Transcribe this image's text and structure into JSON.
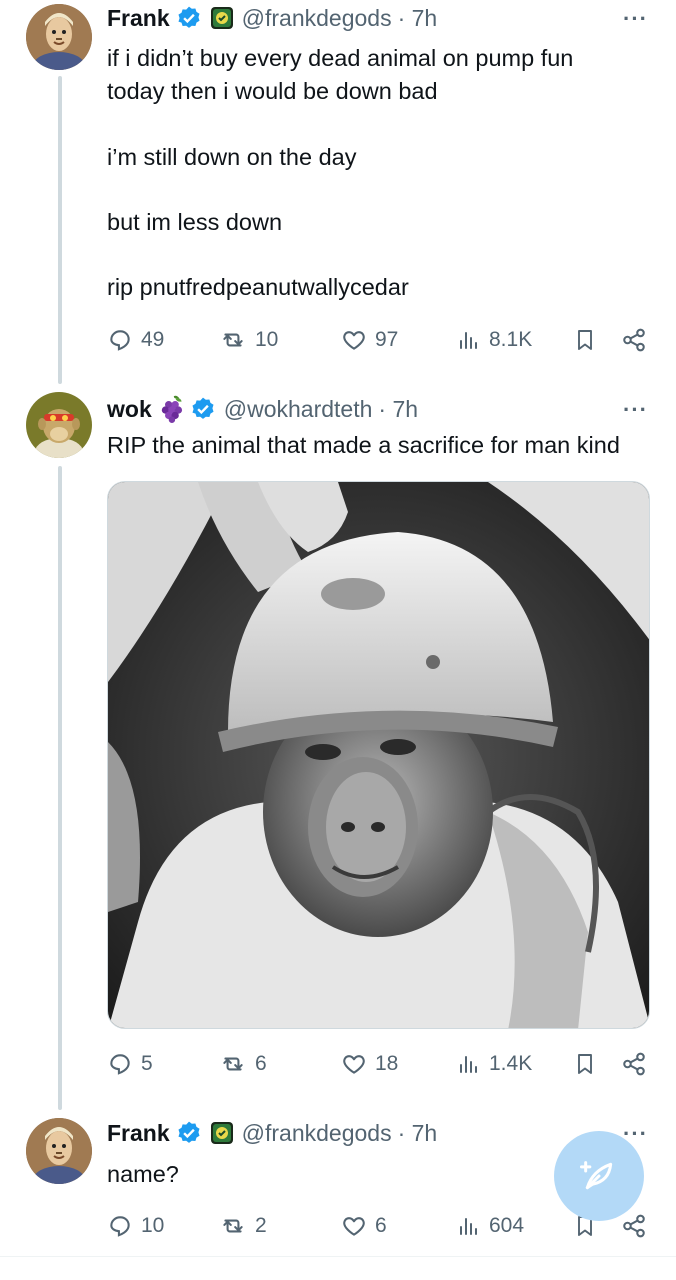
{
  "tweets": [
    {
      "name": "Frank",
      "handle": "@frankdegods",
      "time": "· 7h",
      "paragraphs": [
        "if i didn’t buy every dead animal on pump fun today then i would be down bad",
        "i’m still down on the day",
        "but im less down",
        "rip pnutfredpeanutwallycedar"
      ],
      "replies": "49",
      "reposts": "10",
      "likes": "97",
      "views": "8.1K"
    },
    {
      "name": "wok",
      "handle": "@wokhardteth",
      "time": "· 7h",
      "paragraphs": [
        "RIP the animal that made a sacrifice for man kind"
      ],
      "replies": "5",
      "reposts": "6",
      "likes": "18",
      "views": "1.4K"
    },
    {
      "name": "Frank",
      "handle": "@frankdegods",
      "time": "· 7h",
      "paragraphs": [
        "name?"
      ],
      "replies": "10",
      "reposts": "2",
      "likes": "6",
      "views": "604"
    }
  ],
  "more_label": "···",
  "colors": {
    "verified": "#1d9bf0",
    "muted": "#536471",
    "thread": "#cfd9de",
    "fab": "#b3d9f7"
  },
  "icons": [
    "verified-icon",
    "reply-icon",
    "repost-icon",
    "like-icon",
    "views-icon",
    "bookmark-icon",
    "share-icon",
    "compose-icon"
  ]
}
